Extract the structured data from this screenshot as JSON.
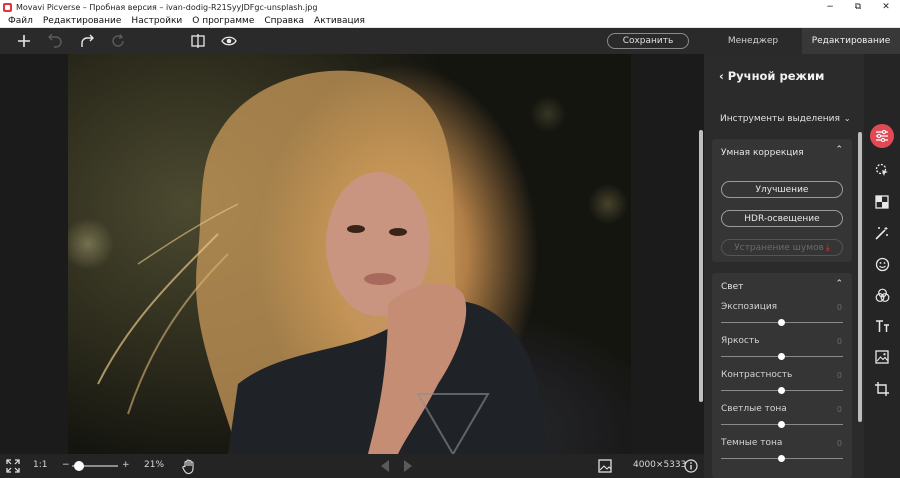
{
  "window": {
    "title": "Movavi Picverse – Пробная версия – ivan-dodig-R21SyyJDFgc-unsplash.jpg",
    "minimize": "−",
    "maximize": "⧉",
    "close": "✕"
  },
  "menu": {
    "items": [
      "Файл",
      "Редактирование",
      "Настройки",
      "О программе",
      "Справка",
      "Активация"
    ]
  },
  "toolbar": {
    "save_label": "Сохранить",
    "tab_manager": "Менеджер",
    "tab_edit": "Редактирование",
    "active_tab": "Редактирование"
  },
  "bottombar": {
    "fit_ratio": "1:1",
    "zoom_minus": "−",
    "zoom_plus": "+",
    "zoom_level": "21%",
    "zoom_fraction": 0.21,
    "dimensions": "4000×5333"
  },
  "panel": {
    "title": "Ручной режим",
    "selection_tools": "Инструменты выделения",
    "smart": {
      "title": "Умная коррекция",
      "buttons": [
        {
          "label": "Улучшение",
          "enabled": true
        },
        {
          "label": "HDR-освещение",
          "enabled": true
        },
        {
          "label": "Устранение шумов",
          "enabled": false
        }
      ]
    },
    "light": {
      "title": "Свет",
      "sliders": [
        {
          "label": "Экспозиция",
          "value": "0"
        },
        {
          "label": "Яркость",
          "value": "0"
        },
        {
          "label": "Контрастность",
          "value": "0"
        },
        {
          "label": "Светлые тона",
          "value": "0"
        },
        {
          "label": "Темные тона",
          "value": "0"
        }
      ]
    }
  },
  "rail": {
    "icons": [
      "sliders-icon",
      "selection-cursor-icon",
      "auto-enhance-icon",
      "magic-wand-icon",
      "face-retouch-icon",
      "color-filters-icon",
      "text-icon",
      "image-replace-icon",
      "crop-icon"
    ],
    "active": "sliders-icon"
  },
  "colors": {
    "accent": "#e14a55",
    "logo": "#e2363e",
    "panel_bg": "#2b2b2b",
    "canvas_bg": "#1b1b1b"
  }
}
